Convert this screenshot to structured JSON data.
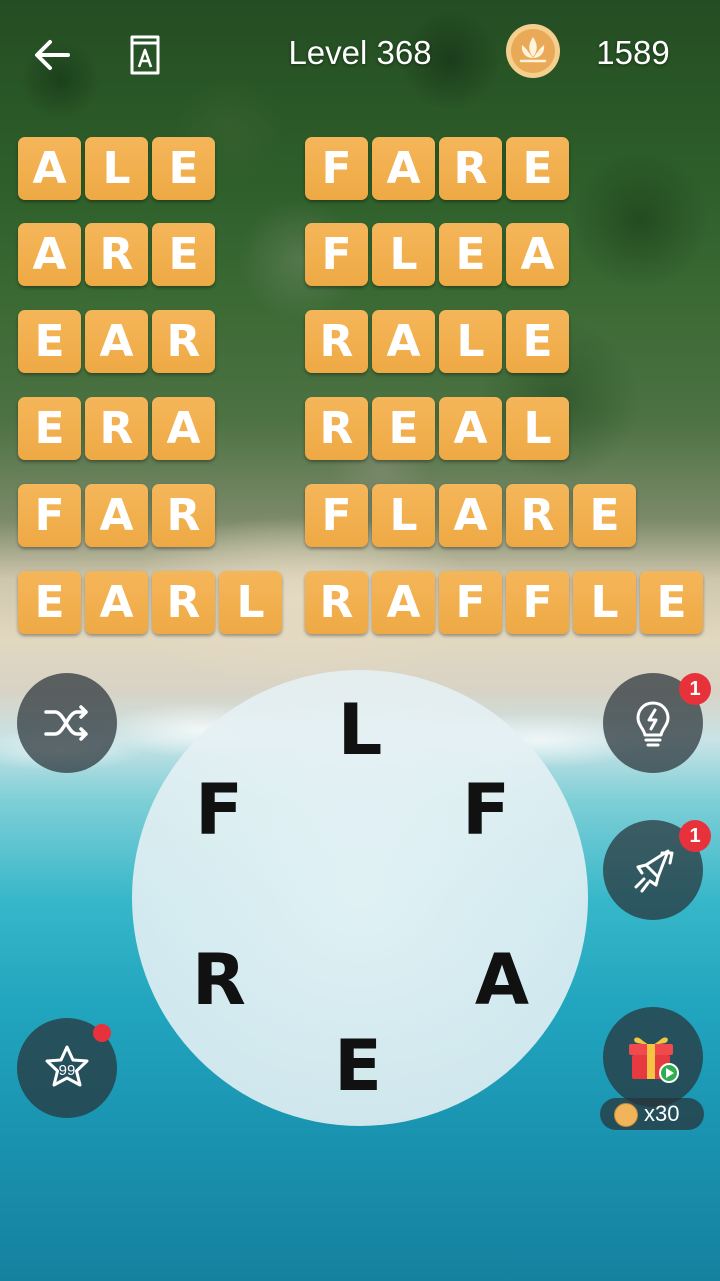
{
  "header": {
    "back_icon": "arrow-left-icon",
    "dictionary_icon": "dictionary-a-icon",
    "level_title": "Level 368",
    "coin_icon": "lotus-coin-icon",
    "coins": "1589"
  },
  "words": [
    {
      "word": "ALE",
      "letters": [
        "A",
        "L",
        "E"
      ]
    },
    {
      "word": "ARE",
      "letters": [
        "A",
        "R",
        "E"
      ]
    },
    {
      "word": "EAR",
      "letters": [
        "E",
        "A",
        "R"
      ]
    },
    {
      "word": "ERA",
      "letters": [
        "E",
        "R",
        "A"
      ]
    },
    {
      "word": "FAR",
      "letters": [
        "F",
        "A",
        "R"
      ]
    },
    {
      "word": "EARL",
      "letters": [
        "E",
        "A",
        "R",
        "L"
      ]
    },
    {
      "word": "FARE",
      "letters": [
        "F",
        "A",
        "R",
        "E"
      ]
    },
    {
      "word": "FLEA",
      "letters": [
        "F",
        "L",
        "E",
        "A"
      ]
    },
    {
      "word": "RALE",
      "letters": [
        "R",
        "A",
        "L",
        "E"
      ]
    },
    {
      "word": "REAL",
      "letters": [
        "R",
        "E",
        "A",
        "L"
      ]
    },
    {
      "word": "FLARE",
      "letters": [
        "F",
        "L",
        "A",
        "R",
        "E"
      ]
    },
    {
      "word": "RAFFLE",
      "letters": [
        "R",
        "A",
        "F",
        "F",
        "L",
        "E"
      ]
    }
  ],
  "wheel": {
    "letters": [
      "L",
      "F",
      "A",
      "E",
      "R",
      "F"
    ]
  },
  "buttons": {
    "shuffle_icon": "shuffle-icon",
    "hint_icon": "lightbulb-icon",
    "hint_badge": "1",
    "rocket_icon": "rocket-icon",
    "rocket_badge": "1",
    "bonus_words_icon": "star-icon",
    "bonus_words_count": "99",
    "gift_icon": "gift-icon",
    "gift_reward": "x30"
  },
  "colors": {
    "tile": "#f0ad4e",
    "badge": "#e8323b"
  }
}
